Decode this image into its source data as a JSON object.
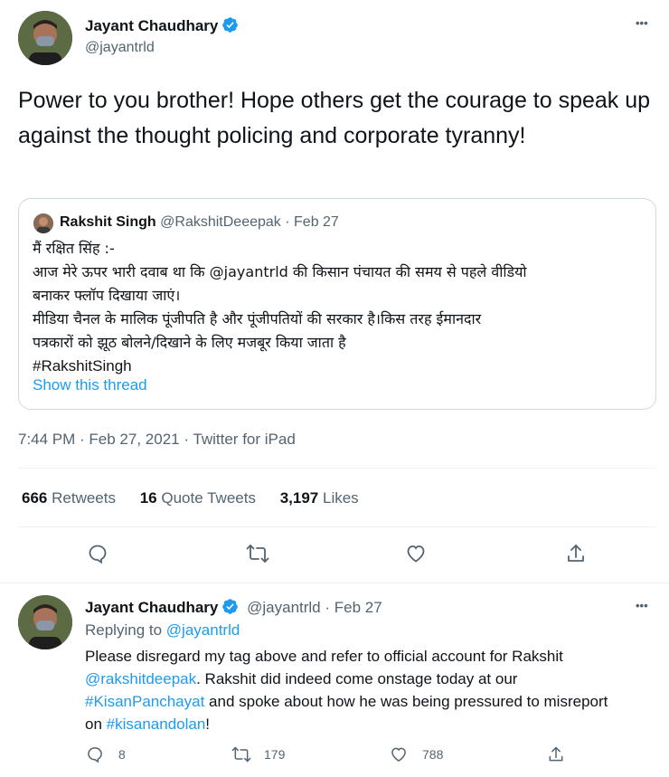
{
  "main_tweet": {
    "author_name": "Jayant Chaudhary",
    "author_handle": "@jayantrld",
    "more_label": "•••",
    "text": "Power to you brother! Hope others get the courage to speak up against the thought policing and corporate tyranny!",
    "timestamp": "7:44 PM · Feb 27, 2021 · Twitter for iPad"
  },
  "quoted_tweet": {
    "author_name": "Rakshit Singh",
    "author_handle": "@RakshitDeeepak",
    "date_sep": "·",
    "date": "Feb 27",
    "lines": [
      "मैं रक्षित सिंह :-",
      "आज मेरे ऊपर भारी दवाब था कि @jayantrld की किसान पंचायत की समय से पहले वीडियो",
      "बनाकर फ्लॉप दिखाया जाएं।",
      "मीडिया चैनल के मालिक पूंजीपति है और पूंजीपतियों की सरकार है।किस तरह ईमानदार",
      "पत्रकारों को झूठ बोलने/दिखाने के लिए मजबूर किया जाता है",
      "#RakshitSingh"
    ],
    "show_thread": "Show this thread"
  },
  "stats": {
    "retweets_count": "666",
    "retweets_label": "Retweets",
    "quotes_count": "16",
    "quotes_label": "Quote Tweets",
    "likes_count": "3,197",
    "likes_label": "Likes"
  },
  "reply_tweet": {
    "author_name": "Jayant Chaudhary",
    "author_handle": "@jayantrld",
    "date_sep": "·",
    "date": "Feb 27",
    "more_label": "•••",
    "replying_prefix": "Replying to",
    "replying_to": "@jayantrld",
    "line1": "Please disregard my tag above and refer to official account for Rakshit",
    "line2_link": "@rakshitdeepak",
    "line2_rest": ". Rakshit did indeed come onstage today at our",
    "line3_link": "#KisanPanchayat",
    "line3_rest": " and spoke about how he was being pressured to misreport",
    "line4_prefix": "on ",
    "line4_link": "#kisanandolan",
    "line4_rest": "!",
    "reply_count": "8",
    "retweet_count": "179",
    "like_count": "788"
  },
  "icons": {
    "verified": "verified-badge-icon",
    "reply": "reply-icon",
    "retweet": "retweet-icon",
    "like": "heart-icon",
    "share": "share-icon"
  },
  "colors": {
    "accent": "#1d9bf0",
    "muted": "#536471",
    "border": "#cfd9de"
  }
}
